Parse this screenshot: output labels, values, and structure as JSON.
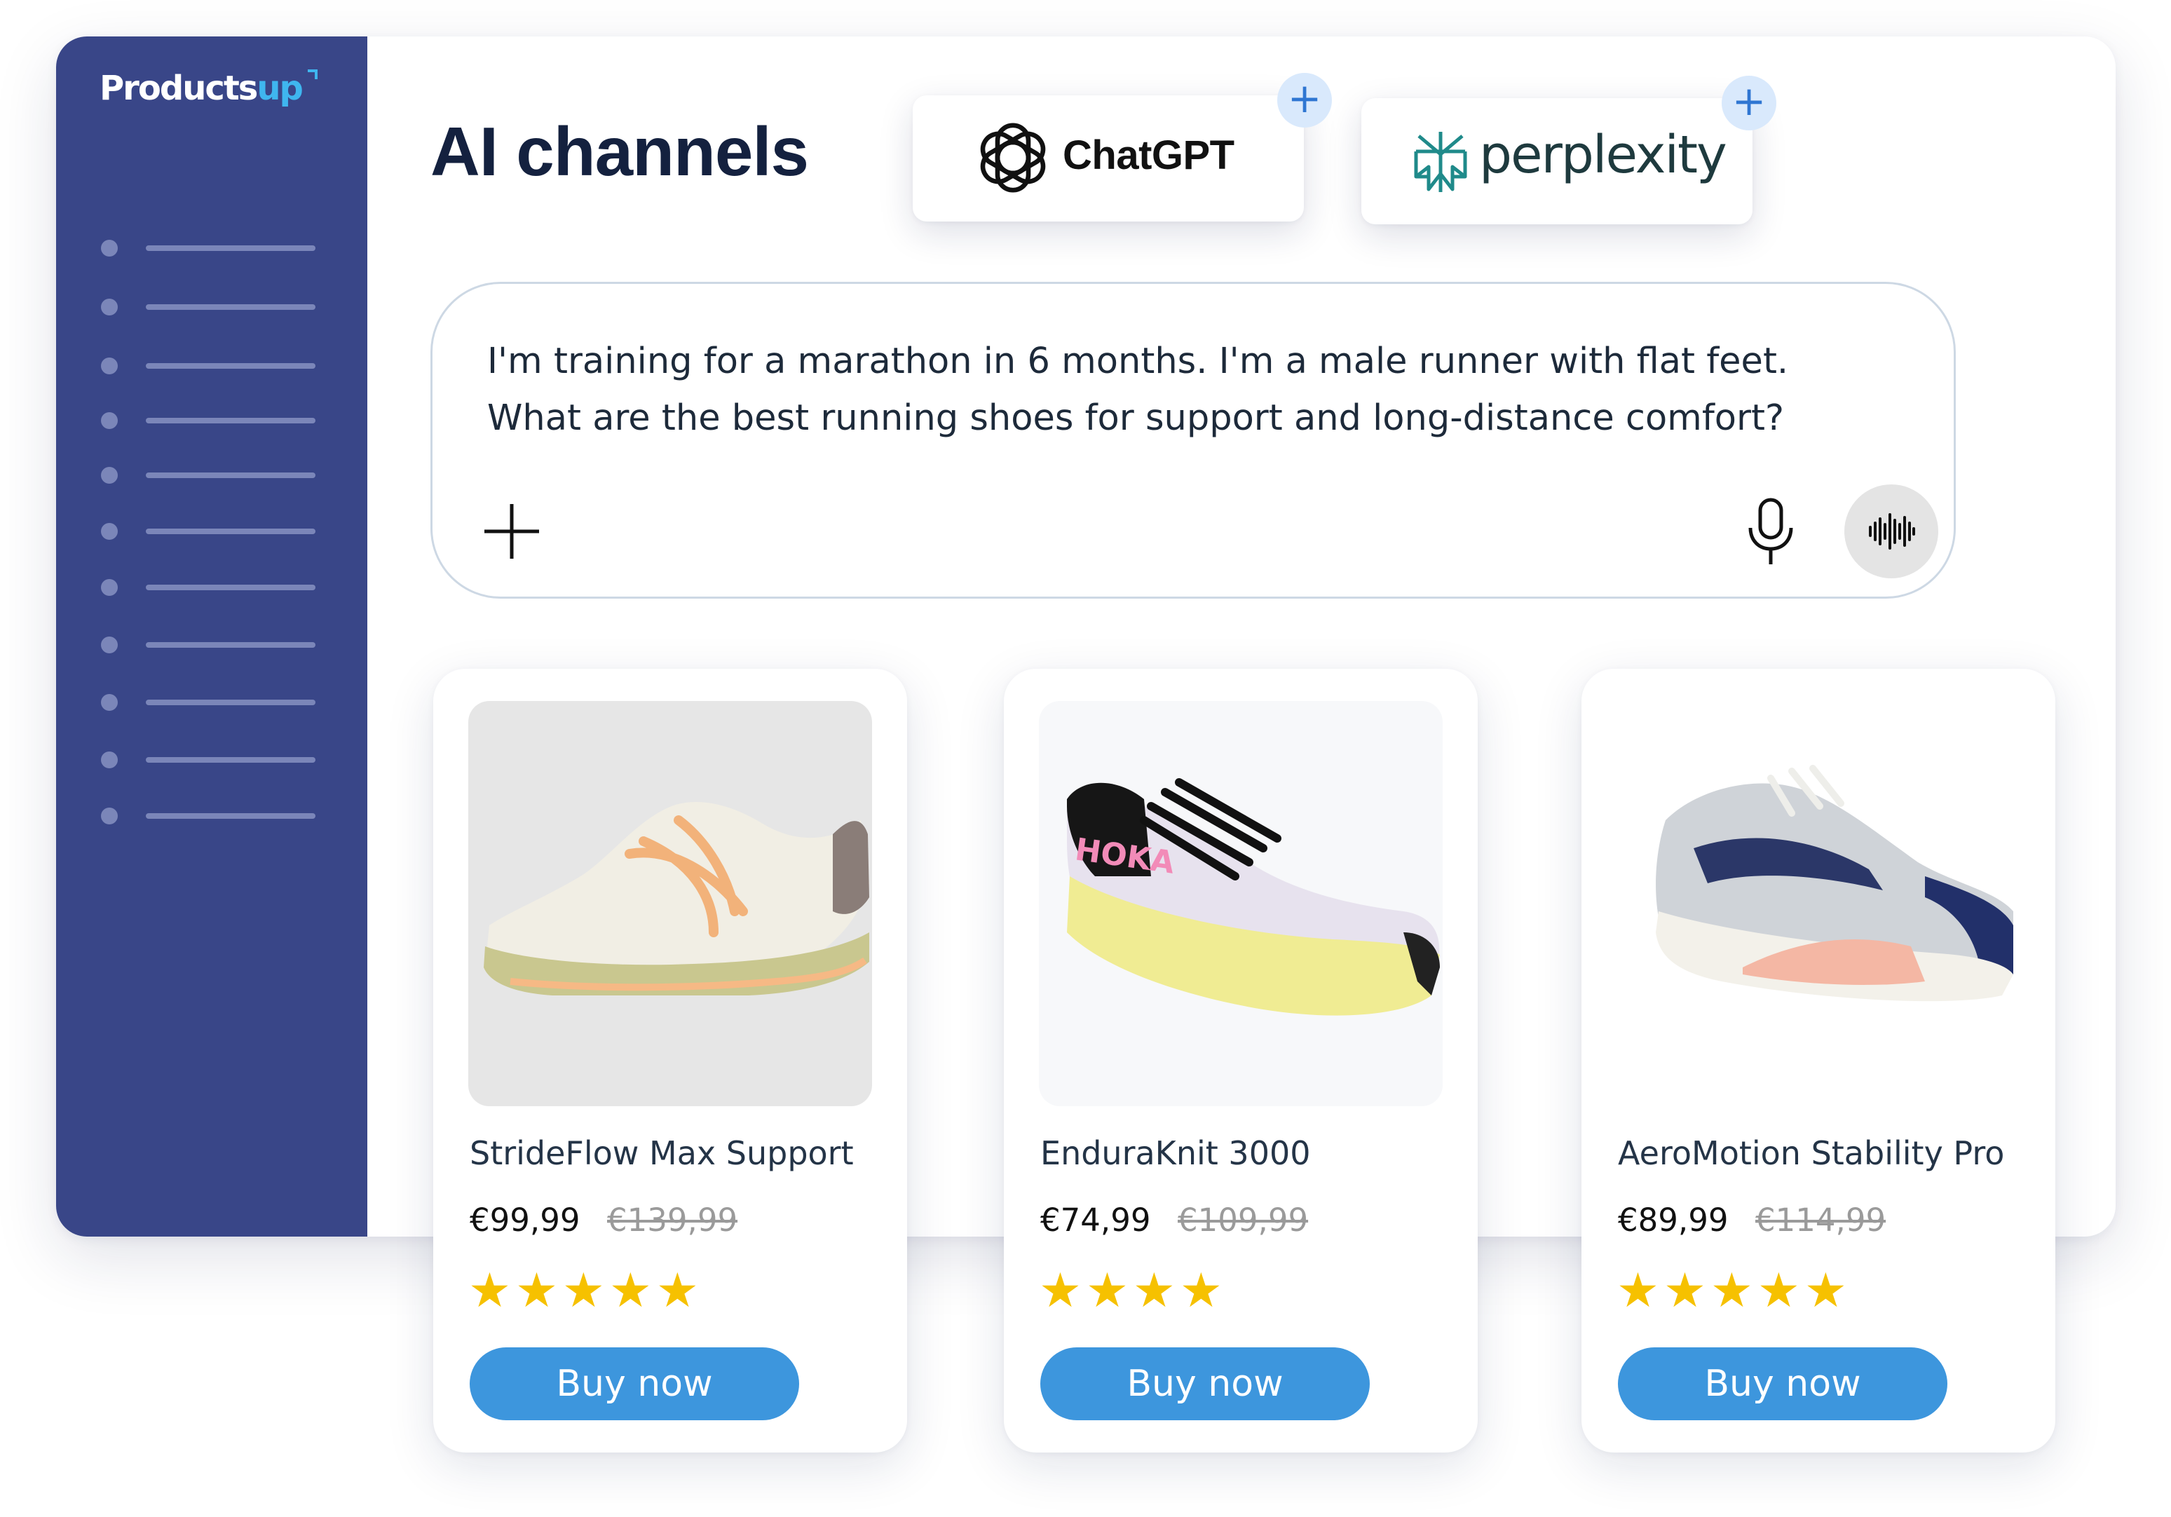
{
  "brand": {
    "logo_main": "Products",
    "logo_accent": "up"
  },
  "sidebar": {
    "item_count": 11
  },
  "header": {
    "title": "AI channels"
  },
  "channels": [
    {
      "name": "ChatGPT",
      "icon": "chatgpt-logo-icon",
      "add_icon": "+"
    },
    {
      "name": "perplexity",
      "icon": "perplexity-logo-icon",
      "add_icon": "+"
    }
  ],
  "prompt": {
    "text": "I'm training for a marathon in 6 months. I'm a male runner with flat feet. What are the best running shoes for support and long-distance comfort?",
    "attach_icon": "plus-icon",
    "mic_icon": "microphone-icon",
    "voice_icon": "voice-waveform-icon"
  },
  "products": [
    {
      "name": "StrideFlow Max Support",
      "price": "€99,99",
      "old_price": "€139,99",
      "stars": "★★★★★",
      "rating": 5,
      "button": "Buy now"
    },
    {
      "name": "EnduraKnit 3000",
      "price": "€74,99",
      "old_price": "€109,99",
      "stars": "★★★★",
      "rating": 4,
      "button": "Buy now"
    },
    {
      "name": "AeroMotion Stability Pro",
      "price": "€89,99",
      "old_price": "€114,99",
      "stars": "★★★★★",
      "rating": 5,
      "button": "Buy now"
    }
  ],
  "colors": {
    "sidebar": "#394688",
    "accent_button": "#3d96dd",
    "star": "#f6c100",
    "title": "#14213f"
  }
}
